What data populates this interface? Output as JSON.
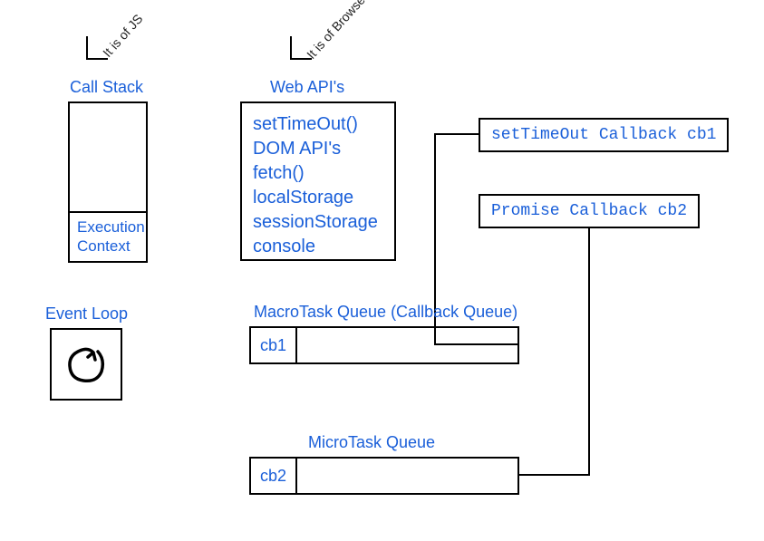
{
  "annotations": {
    "js": "It is of JS",
    "browser": "It is of Browser's"
  },
  "callStack": {
    "title": "Call Stack",
    "execContext": "Execution\nContext"
  },
  "eventLoop": {
    "title": "Event Loop"
  },
  "webApi": {
    "title": "Web API's",
    "items": {
      "a": "setTimeOut()",
      "b": "DOM API's",
      "c": "fetch()",
      "d": "localStorage",
      "e": "sessionStorage",
      "f": "console"
    }
  },
  "callbacks": {
    "cb1": "setTimeOut Callback cb1",
    "cb2": "Promise Callback cb2"
  },
  "macroQueue": {
    "title": "MacroTask Queue (Callback Queue)",
    "item": "cb1"
  },
  "microQueue": {
    "title": "MicroTask Queue",
    "item": "cb2"
  }
}
